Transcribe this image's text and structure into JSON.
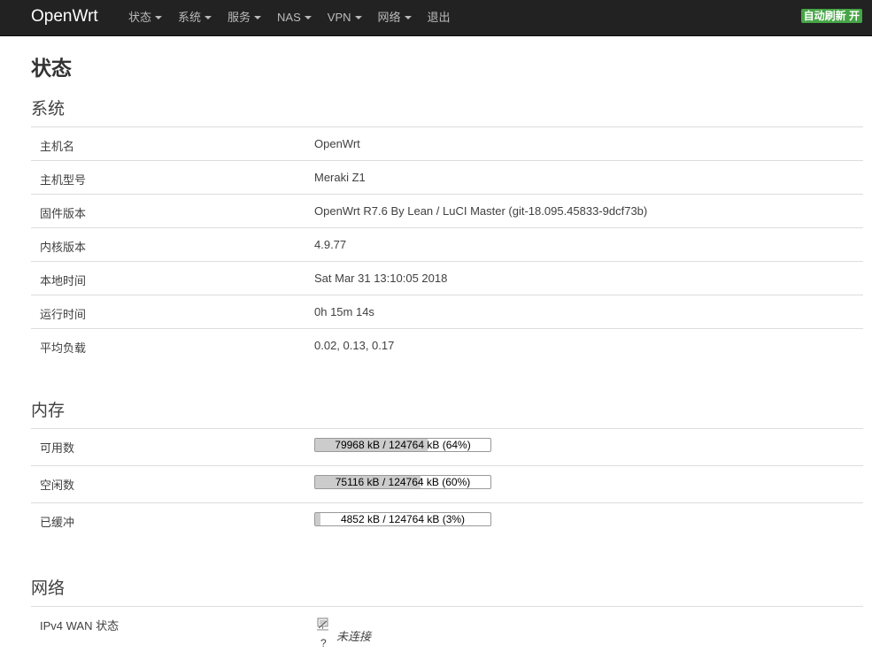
{
  "navbar": {
    "brand": "OpenWrt",
    "menu": [
      {
        "label": "状态",
        "dropdown": true
      },
      {
        "label": "系统",
        "dropdown": true
      },
      {
        "label": "服务",
        "dropdown": true
      },
      {
        "label": "NAS",
        "dropdown": true
      },
      {
        "label": "VPN",
        "dropdown": true
      },
      {
        "label": "网络",
        "dropdown": true
      },
      {
        "label": "退出",
        "dropdown": false
      }
    ],
    "refresh_badge": "自动刷新 开"
  },
  "page_title": "状态",
  "system": {
    "title": "系统",
    "rows": [
      {
        "key": "主机名",
        "value": "OpenWrt"
      },
      {
        "key": "主机型号",
        "value": "Meraki Z1"
      },
      {
        "key": "固件版本",
        "value": "OpenWrt R7.6 By Lean / LuCI Master (git-18.095.45833-9dcf73b)"
      },
      {
        "key": "内核版本",
        "value": "4.9.77"
      },
      {
        "key": "本地时间",
        "value": "Sat Mar 31 13:10:05 2018"
      },
      {
        "key": "运行时间",
        "value": "0h 15m 14s"
      },
      {
        "key": "平均负载",
        "value": "0.02, 0.13, 0.17"
      }
    ]
  },
  "memory": {
    "title": "内存",
    "rows": [
      {
        "key": "可用数",
        "text": "79968 kB / 124764 kB (64%)",
        "percent": 64
      },
      {
        "key": "空闲数",
        "text": "75116 kB / 124764 kB (60%)",
        "percent": 60
      },
      {
        "key": "已缓冲",
        "text": "4852 kB / 124764 kB (3%)",
        "percent": 3
      }
    ]
  },
  "network": {
    "title": "网络",
    "wan_label": "IPv4 WAN 状态",
    "wan_icon_caption": "?",
    "wan_status": "未连接"
  },
  "colors": {
    "navbar_bg": "#222222",
    "badge_bg": "#46a546",
    "bar_fill": "#cccccc"
  }
}
